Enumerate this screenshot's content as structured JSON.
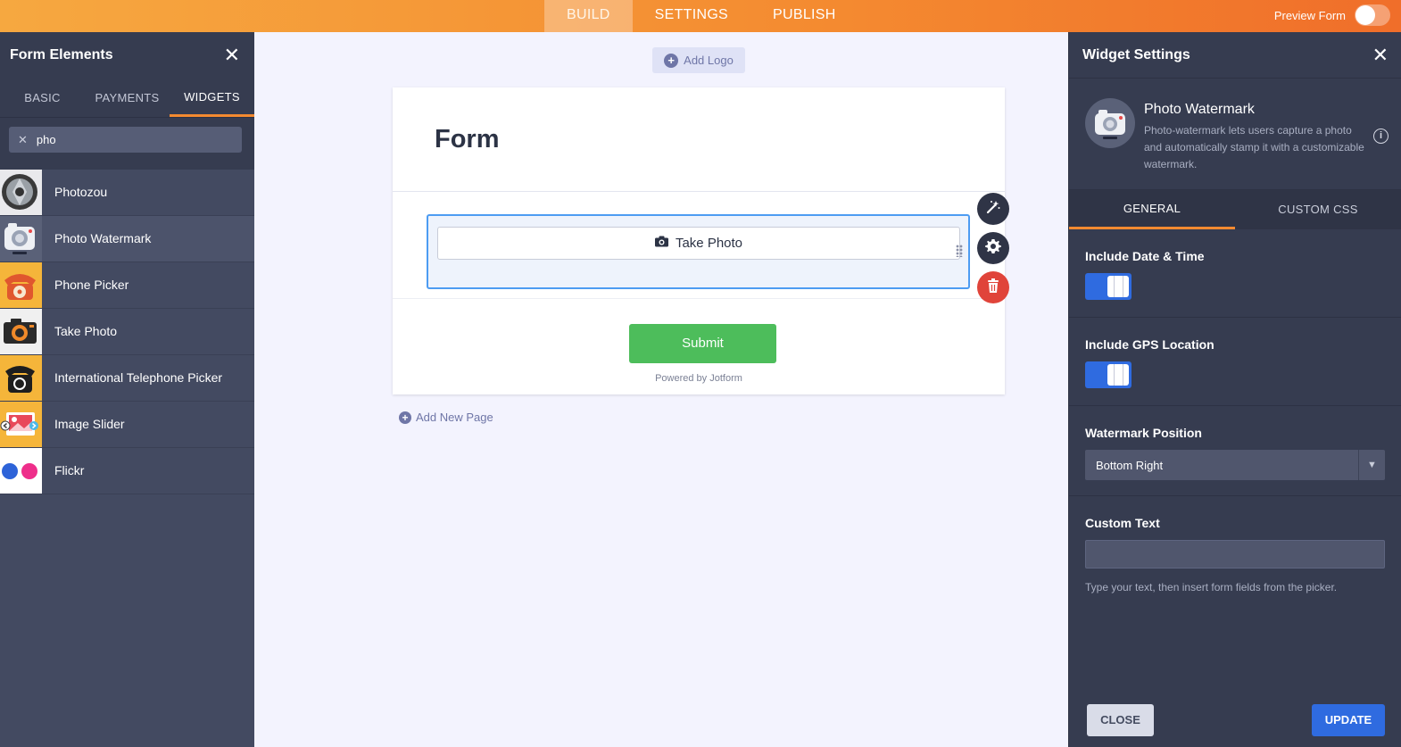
{
  "topbar": {
    "tabs": [
      {
        "label": "BUILD",
        "active": true
      },
      {
        "label": "SETTINGS",
        "active": false
      },
      {
        "label": "PUBLISH",
        "active": false
      }
    ],
    "preview_label": "Preview Form"
  },
  "left_panel": {
    "title": "Form Elements",
    "tabs": [
      {
        "label": "BASIC",
        "active": false
      },
      {
        "label": "PAYMENTS",
        "active": false
      },
      {
        "label": "WIDGETS",
        "active": true
      }
    ],
    "search_value": "pho",
    "widgets": [
      {
        "label": "Photozou",
        "icon": "photozou-icon"
      },
      {
        "label": "Photo Watermark",
        "icon": "camera-icon"
      },
      {
        "label": "Phone Picker",
        "icon": "rotary-phone-icon"
      },
      {
        "label": "Take Photo",
        "icon": "camera-icon"
      },
      {
        "label": "International Telephone Picker",
        "icon": "telephone-icon"
      },
      {
        "label": "Image Slider",
        "icon": "image-slider-icon"
      },
      {
        "label": "Flickr",
        "icon": "flickr-icon"
      }
    ]
  },
  "canvas": {
    "add_logo": "Add Logo",
    "form_title": "Form",
    "take_photo_label": "Take Photo",
    "submit_label": "Submit",
    "powered_by": "Powered by Jotform",
    "add_new_page": "Add New Page"
  },
  "right_panel": {
    "title": "Widget Settings",
    "widget_name": "Photo Watermark",
    "widget_desc": "Photo-watermark lets users capture a photo and automatically stamp it with a customizable watermark.",
    "tabs": [
      {
        "label": "GENERAL",
        "active": true
      },
      {
        "label": "CUSTOM CSS",
        "active": false
      }
    ],
    "include_date_label": "Include Date & Time",
    "include_date_on": true,
    "include_gps_label": "Include GPS Location",
    "include_gps_on": true,
    "watermark_position_label": "Watermark Position",
    "watermark_position_value": "Bottom Right",
    "custom_text_label": "Custom Text",
    "custom_text_value": "",
    "custom_text_hint": "Type your text, then insert form fields from the picker.",
    "close_label": "CLOSE",
    "update_label": "UPDATE"
  },
  "colors": {
    "accent_orange": "#f48a30",
    "primary_blue": "#2f6be0",
    "submit_green": "#4dbd5b",
    "delete_red": "#e0443a"
  }
}
